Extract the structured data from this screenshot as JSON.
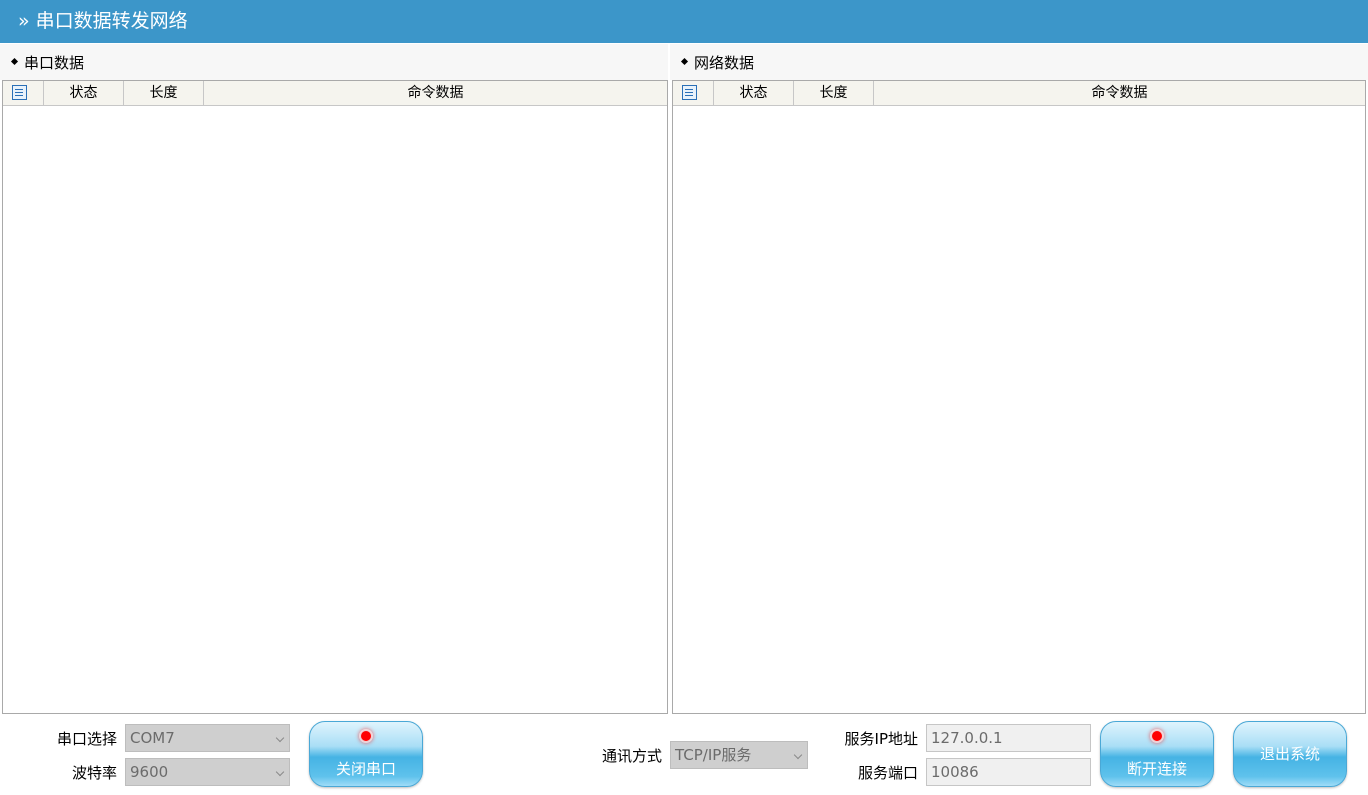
{
  "window": {
    "title": "串口数据转发网络",
    "title_prefix": "»"
  },
  "serial_panel": {
    "label": "串口数据",
    "columns": [
      "状态",
      "长度",
      "命令数据"
    ],
    "rows": []
  },
  "network_panel": {
    "label": "网络数据",
    "columns": [
      "状态",
      "长度",
      "命令数据"
    ],
    "rows": []
  },
  "controls": {
    "port_select_label": "串口选择",
    "port_select_value": "COM7",
    "baud_label": "波特率",
    "baud_value": "9600",
    "close_port_button": "关闭串口",
    "comm_mode_label": "通讯方式",
    "comm_mode_value": "TCP/IP服务",
    "server_ip_label": "服务IP地址",
    "server_ip_value": "127.0.0.1",
    "server_port_label": "服务端口",
    "server_port_value": "10086",
    "disconnect_button": "断开连接",
    "exit_button": "退出系统"
  },
  "colors": {
    "titlebar": "#3c96c9",
    "led_active": "#ff0000"
  }
}
